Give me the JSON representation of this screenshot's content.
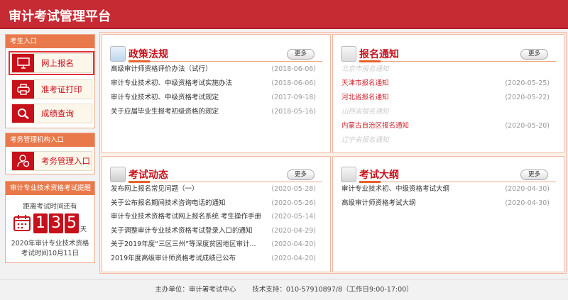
{
  "header": {
    "title": "审计考试管理平台"
  },
  "sidebar": {
    "candidate": {
      "title": "考生入口",
      "buttons": [
        {
          "label": "网上报名",
          "icon": "monitor-icon"
        },
        {
          "label": "准考证打印",
          "icon": "printer-icon"
        },
        {
          "label": "成绩查询",
          "icon": "search-icon"
        }
      ]
    },
    "admin": {
      "title": "考务管理机构入口",
      "buttons": [
        {
          "label": "考务管理入口",
          "icon": "user-gear-icon"
        }
      ]
    },
    "countdown": {
      "title": "审计专业技术资格考试提醒",
      "caption": "距离考试时间还有",
      "digits": [
        "1",
        "3",
        "5"
      ],
      "unit": "天",
      "note1": "2020年审计专业技术资格",
      "note2": "考试时间10月11日"
    }
  },
  "panels": [
    {
      "title": "政策法规",
      "more": "更多",
      "icon": "notebook-icon",
      "items": [
        {
          "title": "高级审计师资格评价办法（试行）",
          "date": "(2018-06-06)"
        },
        {
          "title": "审计专业技术初、中级资格考试实施办法",
          "date": "(2018-06-06)"
        },
        {
          "title": "审计专业技术初、中级资格考试规定",
          "date": "(2017-09-18)"
        },
        {
          "title": "关于应届毕业生报考初级资格的规定",
          "date": "(2018-05-16)"
        }
      ]
    },
    {
      "title": "报名通知",
      "more": "更多",
      "icon": "pencil-icon",
      "items": [
        {
          "title": "北京市报名通知",
          "date": "",
          "state": "dim"
        },
        {
          "title": "天津市报名通知",
          "date": "(2020-05-25)",
          "state": "red"
        },
        {
          "title": "河北省报名通知",
          "date": "(2020-05-22)",
          "state": "red"
        },
        {
          "title": "山西省报名通知",
          "date": "",
          "state": "dim"
        },
        {
          "title": "内蒙古自治区报名通知",
          "date": "(2020-05-20)",
          "state": "red"
        },
        {
          "title": "辽宁省报名通知",
          "date": "",
          "state": "dim"
        }
      ]
    },
    {
      "title": "考试动态",
      "more": "更多",
      "icon": "newspaper-icon",
      "items": [
        {
          "title": "发布网上报名常见问题（一）",
          "date": "(2020-05-28)"
        },
        {
          "title": "关于公布报名期间技术咨询电话的通知",
          "date": "(2020-05-26)"
        },
        {
          "title": "审计专业技术资格考试网上报名系统 考生操作手册",
          "date": "(2020-05-14)"
        },
        {
          "title": "关于调整审计专业技术资格考试登录入口的通知",
          "date": "(2020-04-29)"
        },
        {
          "title": "关于2019年度“三区三州”等深度贫困地区审计...",
          "date": "(2020-04-20)"
        },
        {
          "title": "2019年度高级审计师资格考试成绩已公布",
          "date": "(2020-04-20)"
        }
      ]
    },
    {
      "title": "考试大纲",
      "more": "更多",
      "icon": "table-icon",
      "items": [
        {
          "title": "审计专业技术初、中级资格考试大纲",
          "date": "(2020-04-30)"
        },
        {
          "title": "高级审计师资格考试大纲",
          "date": "(2020-04-30)"
        }
      ]
    }
  ],
  "footer": {
    "host": "主办单位：审计署考试中心",
    "support": "技术支持：010-57910897/8（工作日9:00-17:00）"
  },
  "colors": {
    "header": "#c62a33",
    "accent": "#c8101a",
    "box_header": "#e9794a"
  }
}
